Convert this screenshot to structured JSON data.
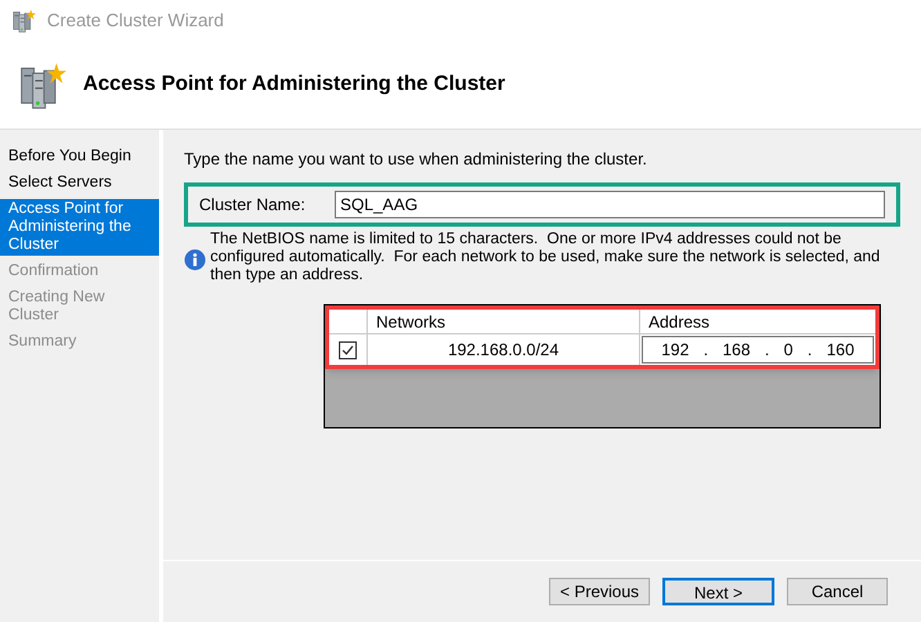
{
  "window": {
    "title": "Create Cluster Wizard"
  },
  "header": {
    "title": "Access Point for Administering the Cluster"
  },
  "steps": [
    {
      "label": "Before You Begin",
      "selected": false,
      "disabled": false
    },
    {
      "label": "Select Servers",
      "selected": false,
      "disabled": false
    },
    {
      "label": "Access Point for Administering the Cluster",
      "selected": true,
      "disabled": false
    },
    {
      "label": "Confirmation",
      "selected": false,
      "disabled": true
    },
    {
      "label": "Creating New Cluster",
      "selected": false,
      "disabled": true
    },
    {
      "label": "Summary",
      "selected": false,
      "disabled": true
    }
  ],
  "instruction": "Type the name you want to use when administering the cluster.",
  "cluster_name": {
    "label": "Cluster Name:",
    "value": "SQL_AAG",
    "highlighted": true
  },
  "info": "The NetBIOS name is limited to 15 characters.  One or more IPv4 addresses could not be configured automatically.  For each network to be used, make sure the network is selected, and then type an address.",
  "network_table": {
    "highlighted": true,
    "columns": [
      "Networks",
      "Address"
    ],
    "rows": [
      {
        "checked": true,
        "network": "192.168.0.0/24",
        "octets": [
          "192",
          "168",
          "0",
          "160"
        ],
        "separator": "."
      }
    ]
  },
  "buttons": [
    {
      "label": "< Previous",
      "default": false
    },
    {
      "label": "Next >",
      "default": true
    },
    {
      "label": "Cancel",
      "default": false
    }
  ]
}
